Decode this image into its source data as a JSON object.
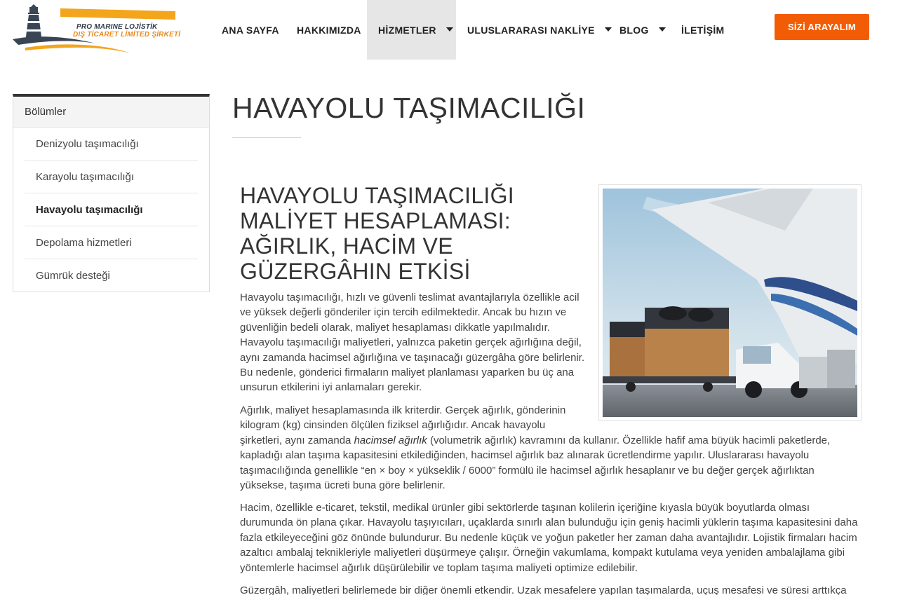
{
  "brand": {
    "line1": "PRO MARINE LOJİSTİK",
    "line2": "DIŞ TİCARET LİMİTED ŞİRKETİ",
    "colors": {
      "dark": "#3a4553",
      "orange": "#f3a51b"
    }
  },
  "nav": {
    "items": [
      {
        "label": "ANA SAYFA",
        "dropdown": false
      },
      {
        "label": "HAKKIMIZDA",
        "dropdown": false
      },
      {
        "label": "HİZMETLER",
        "dropdown": true,
        "active": true
      },
      {
        "label": "ULUSLARARASI NAKLİYE",
        "dropdown": true
      },
      {
        "label": "BLOG",
        "dropdown": true
      },
      {
        "label": "İLETİŞİM",
        "dropdown": false
      }
    ],
    "cta_label": "SİZİ ARAYALIM",
    "cta_color": "#f25c05"
  },
  "sidebar": {
    "title": "Bölümler",
    "items": [
      {
        "label": "Denizyolu taşımacılığı"
      },
      {
        "label": "Karayolu taşımacılığı"
      },
      {
        "label": "Havayolu taşımacılığı",
        "current": true
      },
      {
        "label": "Depolama hizmetleri"
      },
      {
        "label": "Gümrük desteği"
      }
    ]
  },
  "page": {
    "title": "HAVAYOLU TAŞIMACILIĞI"
  },
  "article": {
    "title": "HAVAYOLU TAŞIMACILIĞI MALİYET HESAPLAMASI: AĞIRLIK, HACİM VE GÜZERGÂHIN ETKİSİ",
    "image_alt_icon": "air-cargo-photo",
    "p1": "Havayolu taşımacılığı, hızlı ve güvenli teslimat avantajlarıyla özellikle acil ve yüksek değerli gönderiler için tercih edilmektedir. Ancak bu hızın ve güvenliğin bedeli olarak, maliyet hesaplaması dikkatle yapılmalıdır. Havayolu taşımacılığı maliyetleri, yalnızca paketin gerçek ağırlığına değil, aynı zamanda hacimsel ağırlığına ve taşınacağı güzergâha göre belirlenir. Bu nedenle, gönderici firmaların maliyet planlaması yaparken bu üç ana unsurun etkilerini iyi anlamaları gerekir.",
    "p2_intro": "Ağırlık, maliyet hesaplamasında ilk kriterdir. Gerçek ağırlık, gönderinin kilogram (kg) cinsinden ölçülen fiziksel ağırlığıdır. Ancak havayolu",
    "p2_before": "şirketleri, aynı zamanda ",
    "p2_em": "hacimsel ağırlık",
    "p2_after": " (volumetrik ağırlık) kavramını da kullanır. Özellikle hafif ama büyük hacimli paketlerde, kapladığı alan taşıma kapasitesini etkilediğinden, hacimsel ağırlık baz alınarak ücretlendirme yapılır. Uluslararası havayolu taşımacılığında genellikle “en × boy × yükseklik / 6000” formülü ile hacimsel ağırlık hesaplanır ve bu değer gerçek ağırlıktan yüksekse, taşıma ücreti buna göre belirlenir.",
    "p3": "Hacim, özellikle e-ticaret, tekstil, medikal ürünler gibi sektörlerde taşınan kolilerin içeriğine kıyasla büyük boyutlarda olması durumunda ön plana çıkar. Havayolu taşıyıcıları, uçaklarda sınırlı alan bulunduğu için geniş hacimli yüklerin taşıma kapasitesini daha fazla etkileyeceğini göz önünde bulundurur. Bu nedenle küçük ve yoğun paketler her zaman daha avantajlıdır. Lojistik firmaları hacim azaltıcı ambalaj teknikleriyle maliyetleri düşürmeye çalışır. Örneğin vakumlama, kompakt kutulama veya yeniden ambalajlama gibi yöntemlerle hacimsel ağırlık düşürülebilir ve toplam taşıma maliyeti optimize edilebilir.",
    "p4": "Güzergâh, maliyetleri belirlemede bir diğer önemli etkendir. Uzak mesafelere yapılan taşımalarda, uçuş mesafesi ve süresi arttıkça"
  }
}
